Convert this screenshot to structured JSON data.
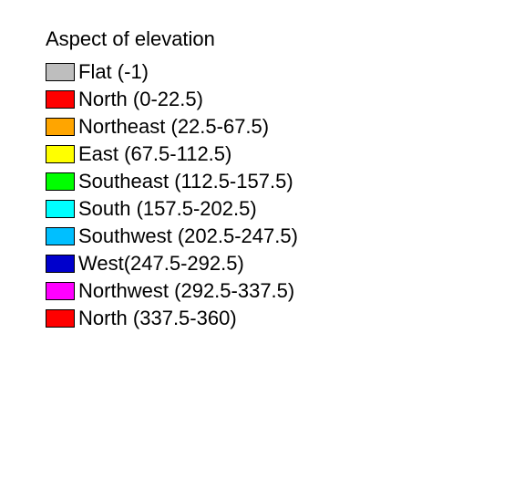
{
  "legend": {
    "title": "Aspect of elevation",
    "items": [
      {
        "color": "#BEBEBE",
        "label": "Flat (-1)"
      },
      {
        "color": "#FF0000",
        "label": "North (0-22.5)"
      },
      {
        "color": "#FFA500",
        "label": "Northeast (22.5-67.5)"
      },
      {
        "color": "#FFFF00",
        "label": "East (67.5-112.5)"
      },
      {
        "color": "#00FF00",
        "label": "Southeast (112.5-157.5)"
      },
      {
        "color": "#00FFFF",
        "label": "South (157.5-202.5)"
      },
      {
        "color": "#00BFFF",
        "label": "Southwest (202.5-247.5)"
      },
      {
        "color": "#0000CC",
        "label": "West(247.5-292.5)"
      },
      {
        "color": "#FF00FF",
        "label": "Northwest (292.5-337.5)"
      },
      {
        "color": "#FF0000",
        "label": "North (337.5-360)"
      }
    ]
  }
}
